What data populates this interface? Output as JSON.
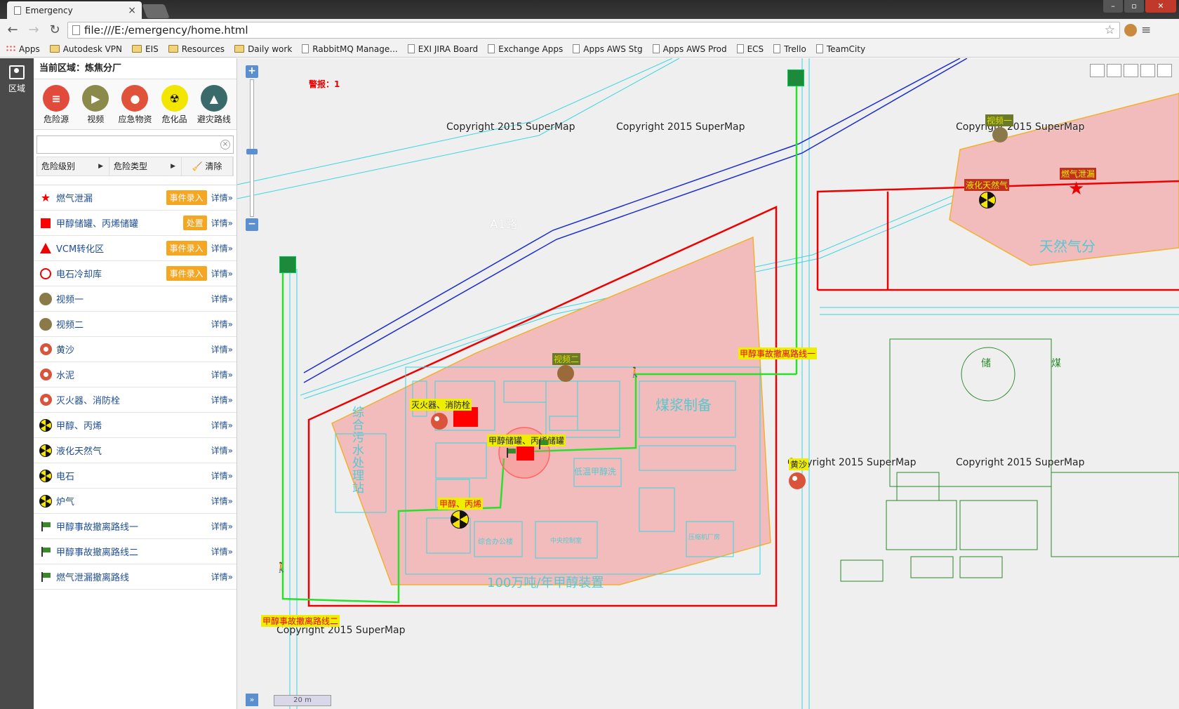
{
  "browser": {
    "tab_title": "Emergency",
    "url": "file:///E:/emergency/home.html",
    "bookmarks": [
      "Apps",
      "Autodesk VPN",
      "EIS",
      "Resources",
      "Daily work",
      "RabbitMQ Manage...",
      "EXI JIRA Board",
      "Exchange Apps",
      "Apps AWS Stg",
      "Apps AWS Prod",
      "ECS",
      "Trello",
      "TeamCity"
    ]
  },
  "leftbar": {
    "label": "区域"
  },
  "panel": {
    "region": "当前区域：炼焦分厂",
    "categories": [
      {
        "label": "危险源",
        "color": "#e24b3b"
      },
      {
        "label": "视频",
        "color": "#8c8a4a"
      },
      {
        "label": "应急物资",
        "color": "#e0523a"
      },
      {
        "label": "危化品",
        "color": "#f2e600"
      },
      {
        "label": "避灾路线",
        "color": "#3a6a6a"
      }
    ],
    "search_placeholder": "",
    "filter_level": "危险级别",
    "filter_type": "危险类型",
    "clear": "清除",
    "items": [
      {
        "marker": "star",
        "name": "燃气泄漏",
        "action": "事件录入",
        "detail": "详情»"
      },
      {
        "marker": "square",
        "name": "甲醇储罐、丙烯储罐",
        "action": "处置",
        "detail": "详情»"
      },
      {
        "marker": "triangle",
        "name": "VCM转化区",
        "action": "事件录入",
        "detail": "详情»"
      },
      {
        "marker": "ring",
        "name": "电石冷却库",
        "action": "事件录入",
        "detail": "详情»"
      },
      {
        "marker": "camera",
        "name": "视频一",
        "action": "",
        "detail": "详情»"
      },
      {
        "marker": "camera",
        "name": "视频二",
        "action": "",
        "detail": "详情»"
      },
      {
        "marker": "pin",
        "name": "黄沙",
        "action": "",
        "detail": "详情»"
      },
      {
        "marker": "pin",
        "name": "水泥",
        "action": "",
        "detail": "详情»"
      },
      {
        "marker": "pin",
        "name": "灭火器、消防栓",
        "action": "",
        "detail": "详情»"
      },
      {
        "marker": "radiation",
        "name": "甲醇、丙烯",
        "action": "",
        "detail": "详情»"
      },
      {
        "marker": "radiation",
        "name": "液化天然气",
        "action": "",
        "detail": "详情»"
      },
      {
        "marker": "radiation",
        "name": "电石",
        "action": "",
        "detail": "详情»"
      },
      {
        "marker": "radiation",
        "name": "炉气",
        "action": "",
        "detail": "详情»"
      },
      {
        "marker": "flag",
        "name": "甲醇事故撤离路线一",
        "action": "",
        "detail": "详情»"
      },
      {
        "marker": "flag",
        "name": "甲醇事故撤离路线二",
        "action": "",
        "detail": "详情»"
      },
      {
        "marker": "flag",
        "name": "燃气泄漏撤离路线",
        "action": "",
        "detail": "详情»"
      }
    ]
  },
  "map": {
    "alarm": "警报：1",
    "copyright": "Copyright 2015 SuperMap",
    "scale": "20 m",
    "zoom_in": "+",
    "zoom_out": "−",
    "expand": "»",
    "labels": {
      "road": "A1路",
      "plant_name": "100万吨/年甲醇装置",
      "coal_slurry": "煤浆制备",
      "sewage": "综合污水处理站",
      "gas_branch": "天然气分",
      "video1": "视频一",
      "video2": "视频二",
      "lng": "液化天然气",
      "gas_leak": "燃气泄漏",
      "fire": "灭火器、消防栓",
      "tanks": "甲醇储罐、丙烯储罐",
      "methanol": "甲醇、丙烯",
      "sand": "黄沙",
      "route1": "甲醇事故撤离路线一",
      "route2": "甲醇事故撤离路线二",
      "storage": "储",
      "coal": "煤",
      "low_temp": "低温甲醇洗",
      "office": "综合办公楼",
      "control": "中央控制室",
      "compressor": "压缩机厂房"
    }
  }
}
